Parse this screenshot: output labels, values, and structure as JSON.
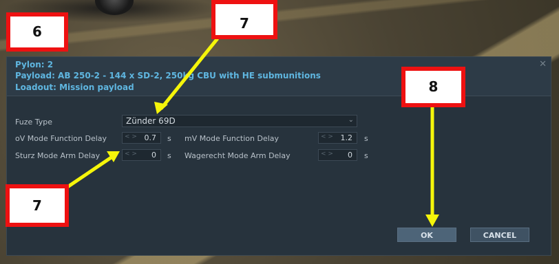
{
  "dialog": {
    "header": {
      "pylon": "Pylon: 2",
      "payload": "Payload: AB 250-2 - 144 x SD-2, 250kg CBU with HE submunitions",
      "loadout": "Loadout: Mission payload",
      "close_icon": "close-icon"
    },
    "fields": {
      "fuze_type_label": "Fuze Type",
      "fuze_type_value": "Zünder 69D",
      "ov_delay_label": "oV Mode Function Delay",
      "ov_delay_value": "0.7",
      "mv_delay_label": "mV Mode Function Delay",
      "mv_delay_value": "1.2",
      "sturz_label": "Sturz Mode Arm Delay",
      "sturz_value": "0",
      "wagerecht_label": "Wagerecht Mode Arm Delay",
      "wagerecht_value": "0",
      "unit": "s",
      "spinner_arrows": "< >"
    },
    "buttons": {
      "ok": "OK",
      "cancel": "CANCEL"
    }
  },
  "callouts": {
    "c6": "6",
    "c7_top": "7",
    "c7_bottom": "7",
    "c8": "8"
  },
  "colors": {
    "callout_border": "#ee1111",
    "arrow": "#f5f50a",
    "header_text": "#5fb6e0"
  }
}
